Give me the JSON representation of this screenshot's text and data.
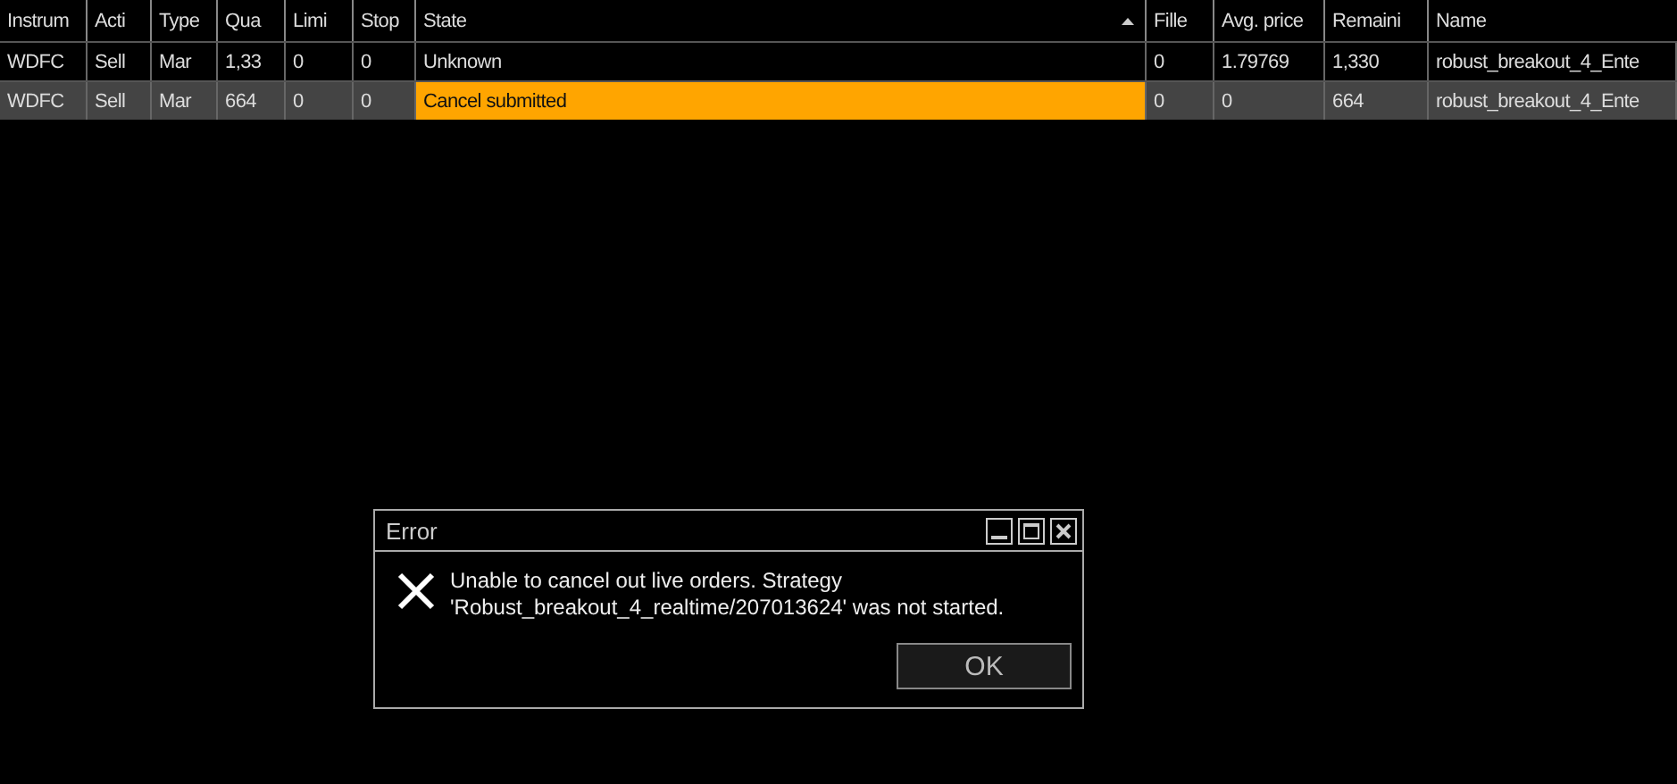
{
  "table": {
    "columns": [
      {
        "label": "Instrum",
        "sorted": false
      },
      {
        "label": "Acti",
        "sorted": false
      },
      {
        "label": "Type",
        "sorted": false
      },
      {
        "label": "Qua",
        "sorted": false
      },
      {
        "label": "Limi",
        "sorted": false
      },
      {
        "label": "Stop",
        "sorted": false
      },
      {
        "label": "State",
        "sorted": true
      },
      {
        "label": "Fille",
        "sorted": false
      },
      {
        "label": "Avg. price",
        "sorted": false
      },
      {
        "label": "Remaini",
        "sorted": false
      },
      {
        "label": "Name",
        "sorted": false
      }
    ],
    "rows": [
      {
        "selected": false,
        "state_highlight": false,
        "cells": [
          "WDFC",
          "Sell",
          "Mar",
          "1,33",
          "0",
          "0",
          "Unknown",
          "0",
          "1.79769",
          "1,330",
          "robust_breakout_4_Ente"
        ]
      },
      {
        "selected": true,
        "state_highlight": true,
        "cells": [
          "WDFC",
          "Sell",
          "Mar",
          "664",
          "0",
          "0",
          "Cancel submitted",
          "0",
          "0",
          "664",
          "robust_breakout_4_Ente"
        ]
      }
    ]
  },
  "dialog": {
    "title": "Error",
    "message": "Unable to cancel out live orders. Strategy 'Robust_breakout_4_realtime/207013624' was not started.",
    "button": "OK"
  }
}
